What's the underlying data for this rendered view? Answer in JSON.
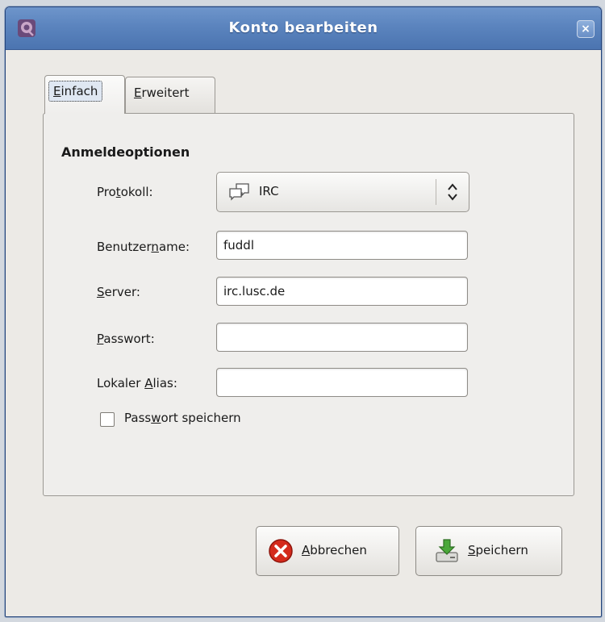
{
  "window": {
    "title": "Konto bearbeiten",
    "close_glyph": "×"
  },
  "tabs": [
    {
      "first": "E",
      "rest": "infach",
      "active": true
    },
    {
      "first": "E",
      "rest": "rweitert",
      "active": false
    }
  ],
  "panel": {
    "section_title": "Anmeldeoptionen",
    "protocol": {
      "pre": "Pro",
      "mnemonic": "t",
      "post": "okoll:",
      "value": "IRC",
      "icon": "chat-bubbles-icon"
    },
    "username": {
      "pre": "Benutzer",
      "mnemonic": "n",
      "post": "ame:",
      "value": "fuddl"
    },
    "server": {
      "pre": "",
      "mnemonic": "S",
      "post": "erver:",
      "value": "irc.lusc.de"
    },
    "password": {
      "pre": "",
      "mnemonic": "P",
      "post": "asswort:",
      "value": ""
    },
    "alias": {
      "pre": "Lokaler ",
      "mnemonic": "A",
      "post": "lias:",
      "value": ""
    },
    "save_password": {
      "pre": "Pass",
      "mnemonic": "w",
      "post": "ort speichern",
      "checked": false
    }
  },
  "buttons": {
    "cancel": {
      "mnemonic": "A",
      "rest": "bbrechen",
      "icon": "cancel-red-icon"
    },
    "save": {
      "mnemonic": "S",
      "rest": "peichern",
      "icon": "save-download-icon"
    }
  },
  "colors": {
    "titlebar": "#5b84be",
    "window_bg": "#eceae6",
    "cancel_red": "#d42a1c",
    "save_green": "#4aa83a"
  }
}
